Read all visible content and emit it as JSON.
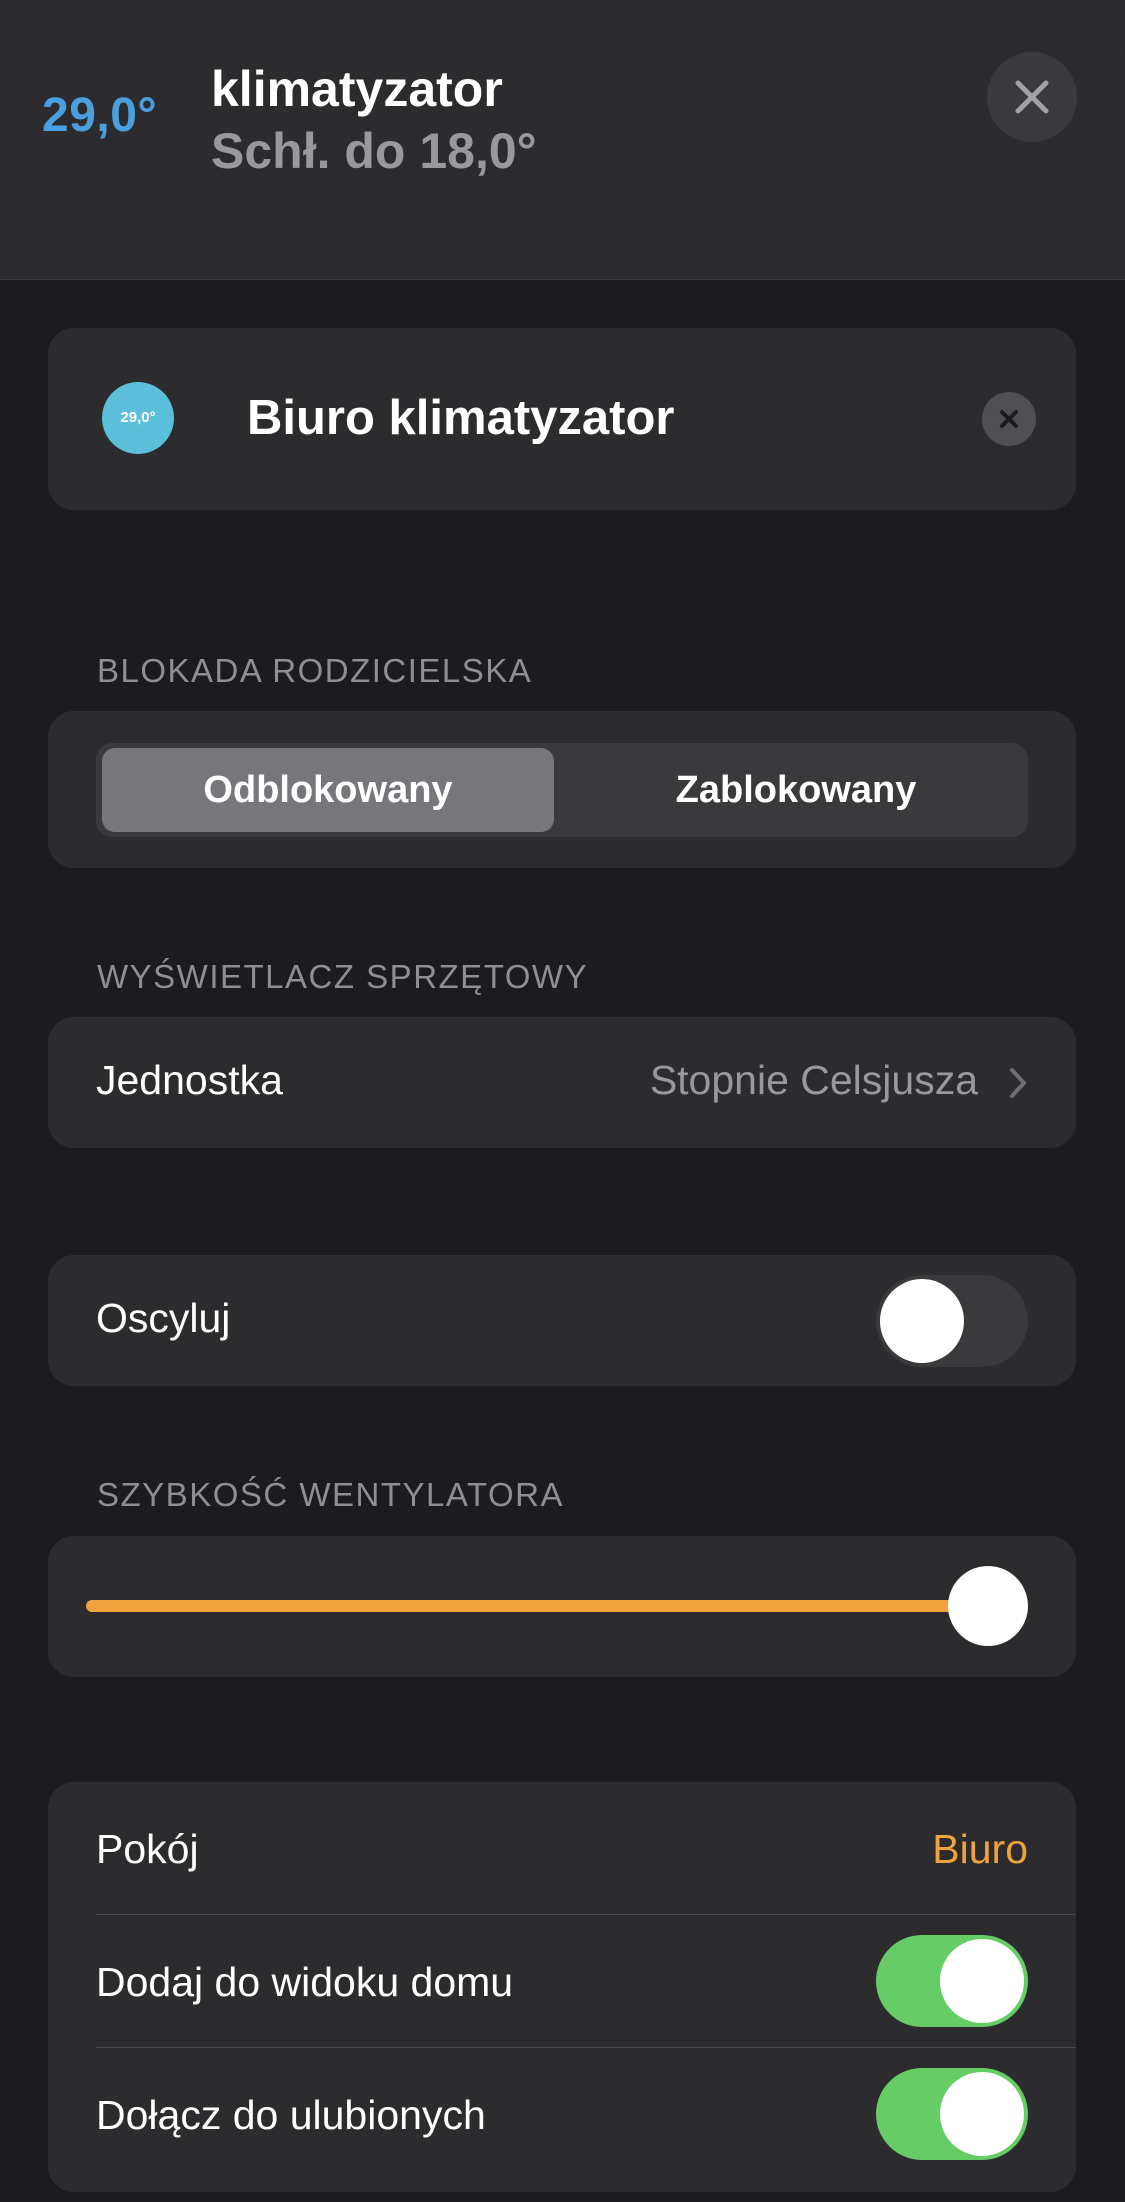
{
  "header": {
    "current_temp": "29,0°",
    "title": "klimatyzator",
    "subtitle": "Schł. do 18,0°"
  },
  "device": {
    "icon_text": "29,0°",
    "name": "Biuro klimatyzator"
  },
  "parental_lock": {
    "section_label": "BLOKADA RODZICIELSKA",
    "options": [
      "Odblokowany",
      "Zablokowany"
    ],
    "selected": "Odblokowany"
  },
  "hardware_display": {
    "section_label": "WYŚWIETLACZ SPRZĘTOWY",
    "unit_label": "Jednostka",
    "unit_value": "Stopnie Celsjusza"
  },
  "oscillate": {
    "label": "Oscyluj",
    "on": false
  },
  "fan_speed": {
    "section_label": "SZYBKOŚĆ WENTYLATORA",
    "level": 1.0
  },
  "settings": {
    "room_label": "Pokój",
    "room_value": "Biuro",
    "home_view_label": "Dodaj do widoku domu",
    "home_view_on": true,
    "favorites_label": "Dołącz do ulubionych",
    "favorites_on": true
  },
  "colors": {
    "accent_orange": "#f0a23c",
    "temp_blue": "#4a9fe0",
    "toggle_green": "#66cc66",
    "device_icon_bg": "#5bbfdc"
  },
  "icons": {
    "close": "close-icon",
    "remove": "remove-icon",
    "chevron": "chevron-right-icon"
  }
}
